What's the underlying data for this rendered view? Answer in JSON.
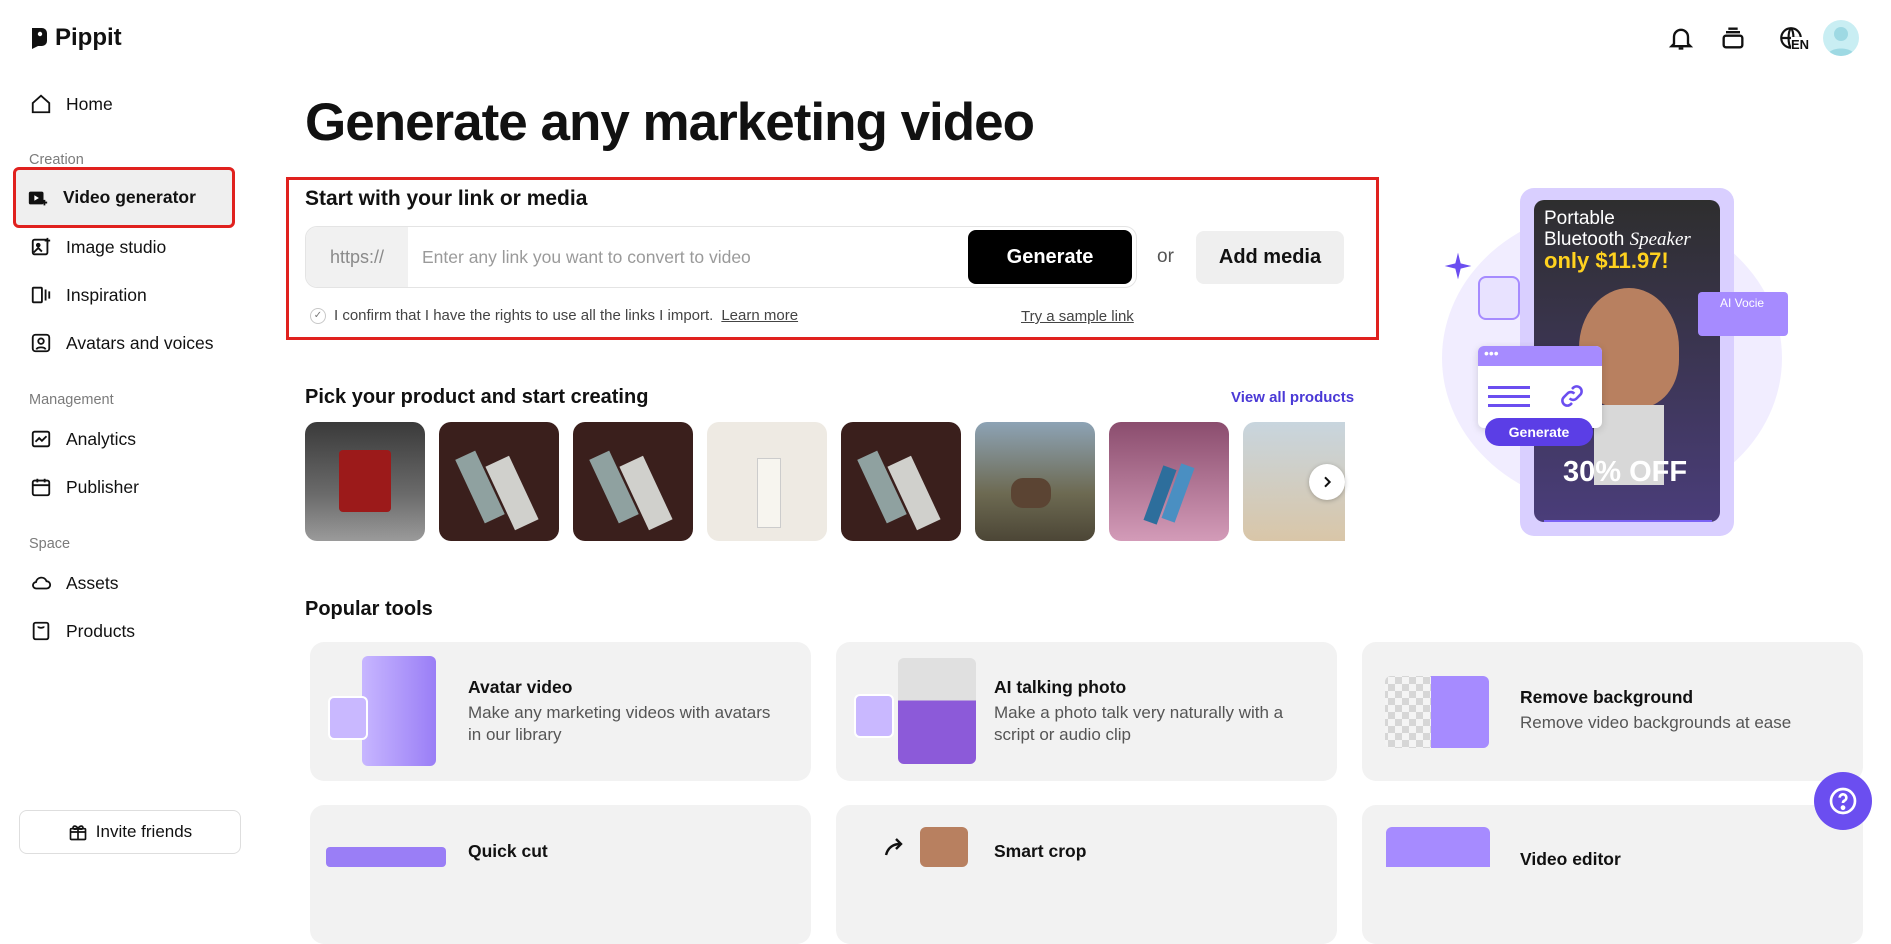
{
  "app": {
    "name": "Pippit"
  },
  "header": {
    "language": "EN"
  },
  "sidebar": {
    "home": "Home",
    "sections": {
      "creation": "Creation",
      "management": "Management",
      "space": "Space"
    },
    "items": {
      "video_generator": "Video generator",
      "image_studio": "Image studio",
      "inspiration": "Inspiration",
      "avatars_voices": "Avatars and voices",
      "analytics": "Analytics",
      "publisher": "Publisher",
      "assets": "Assets",
      "products": "Products"
    },
    "invite": "Invite friends"
  },
  "main": {
    "title": "Generate any marketing video",
    "link_section": {
      "title": "Start with your link or media",
      "prefix": "https://",
      "placeholder": "Enter any link you want to convert to video",
      "generate": "Generate",
      "or": "or",
      "add_media": "Add media",
      "confirm_text": "I confirm that I have the rights to use all the links I import.",
      "learn_more": "Learn more",
      "sample_link": "Try a sample link"
    },
    "products": {
      "title": "Pick your product and start creating",
      "view_all": "View all products"
    },
    "promo": {
      "line1": "Portable",
      "line2": "Bluetooth ",
      "line2_italic": "Speaker",
      "price": "only $11.97!",
      "badge": "AI Vocie",
      "generate": "Generate",
      "discount": "30% OFF"
    },
    "popular": {
      "title": "Popular tools",
      "tools": [
        {
          "title": "Avatar video",
          "desc": "Make any marketing videos with avatars in our library"
        },
        {
          "title": "AI talking photo",
          "desc": "Make a photo talk very naturally with a script or audio clip"
        },
        {
          "title": "Remove background",
          "desc": "Remove video backgrounds at ease"
        },
        {
          "title": "Quick cut",
          "desc": ""
        },
        {
          "title": "Smart crop",
          "desc": ""
        },
        {
          "title": "Video editor",
          "desc": ""
        }
      ]
    }
  },
  "colors": {
    "accent": "#6b4ef0",
    "highlight_border": "#e0211e",
    "link": "#4a39d6"
  }
}
